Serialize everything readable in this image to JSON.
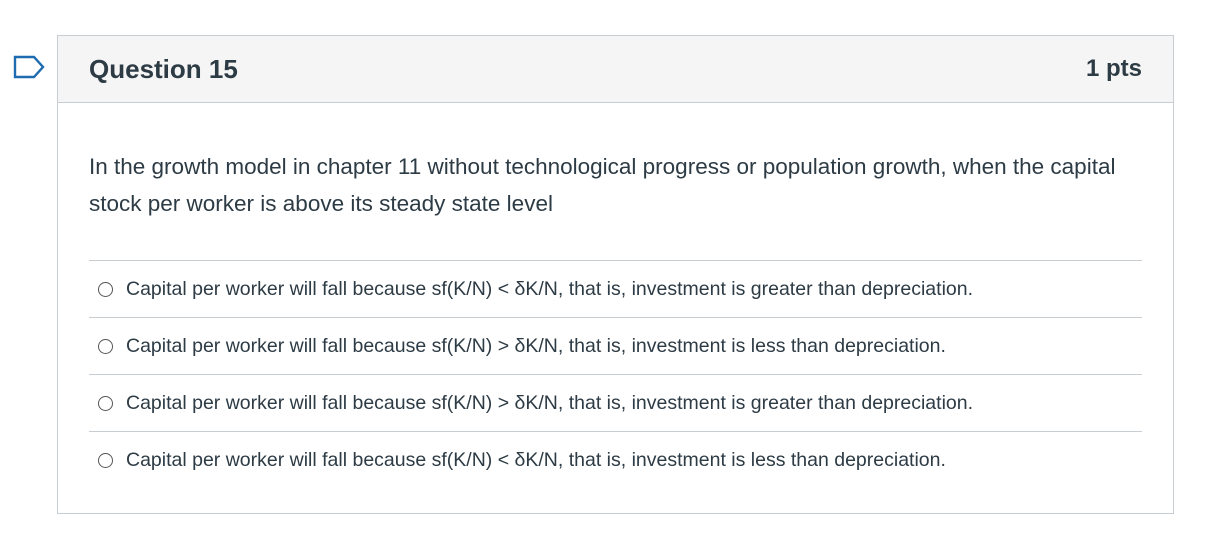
{
  "question": {
    "title": "Question 15",
    "points": "1 pts",
    "text": "In the growth model in chapter 11 without technological progress or population growth, when the capital stock per worker is above its steady state level",
    "answers": [
      {
        "label": "Capital per worker will fall because sf(K/N) < δK/N, that is, investment is greater than depreciation."
      },
      {
        "label": "Capital per worker will fall because sf(K/N) > δK/N, that is, investment is less than depreciation."
      },
      {
        "label": "Capital per worker will fall because sf(K/N) > δK/N, that is, investment is greater than depreciation."
      },
      {
        "label": "Capital per worker will fall because sf(K/N) < δK/N, that is, investment is less than depreciation."
      }
    ]
  },
  "colors": {
    "flag_accent": "#1f6bb0",
    "header_background": "#f5f5f5",
    "border": "#c7cdd1",
    "text": "#2d3b45"
  },
  "icons": {
    "flag": "bookmark-flag-icon",
    "radio": "radio-button-icon"
  }
}
